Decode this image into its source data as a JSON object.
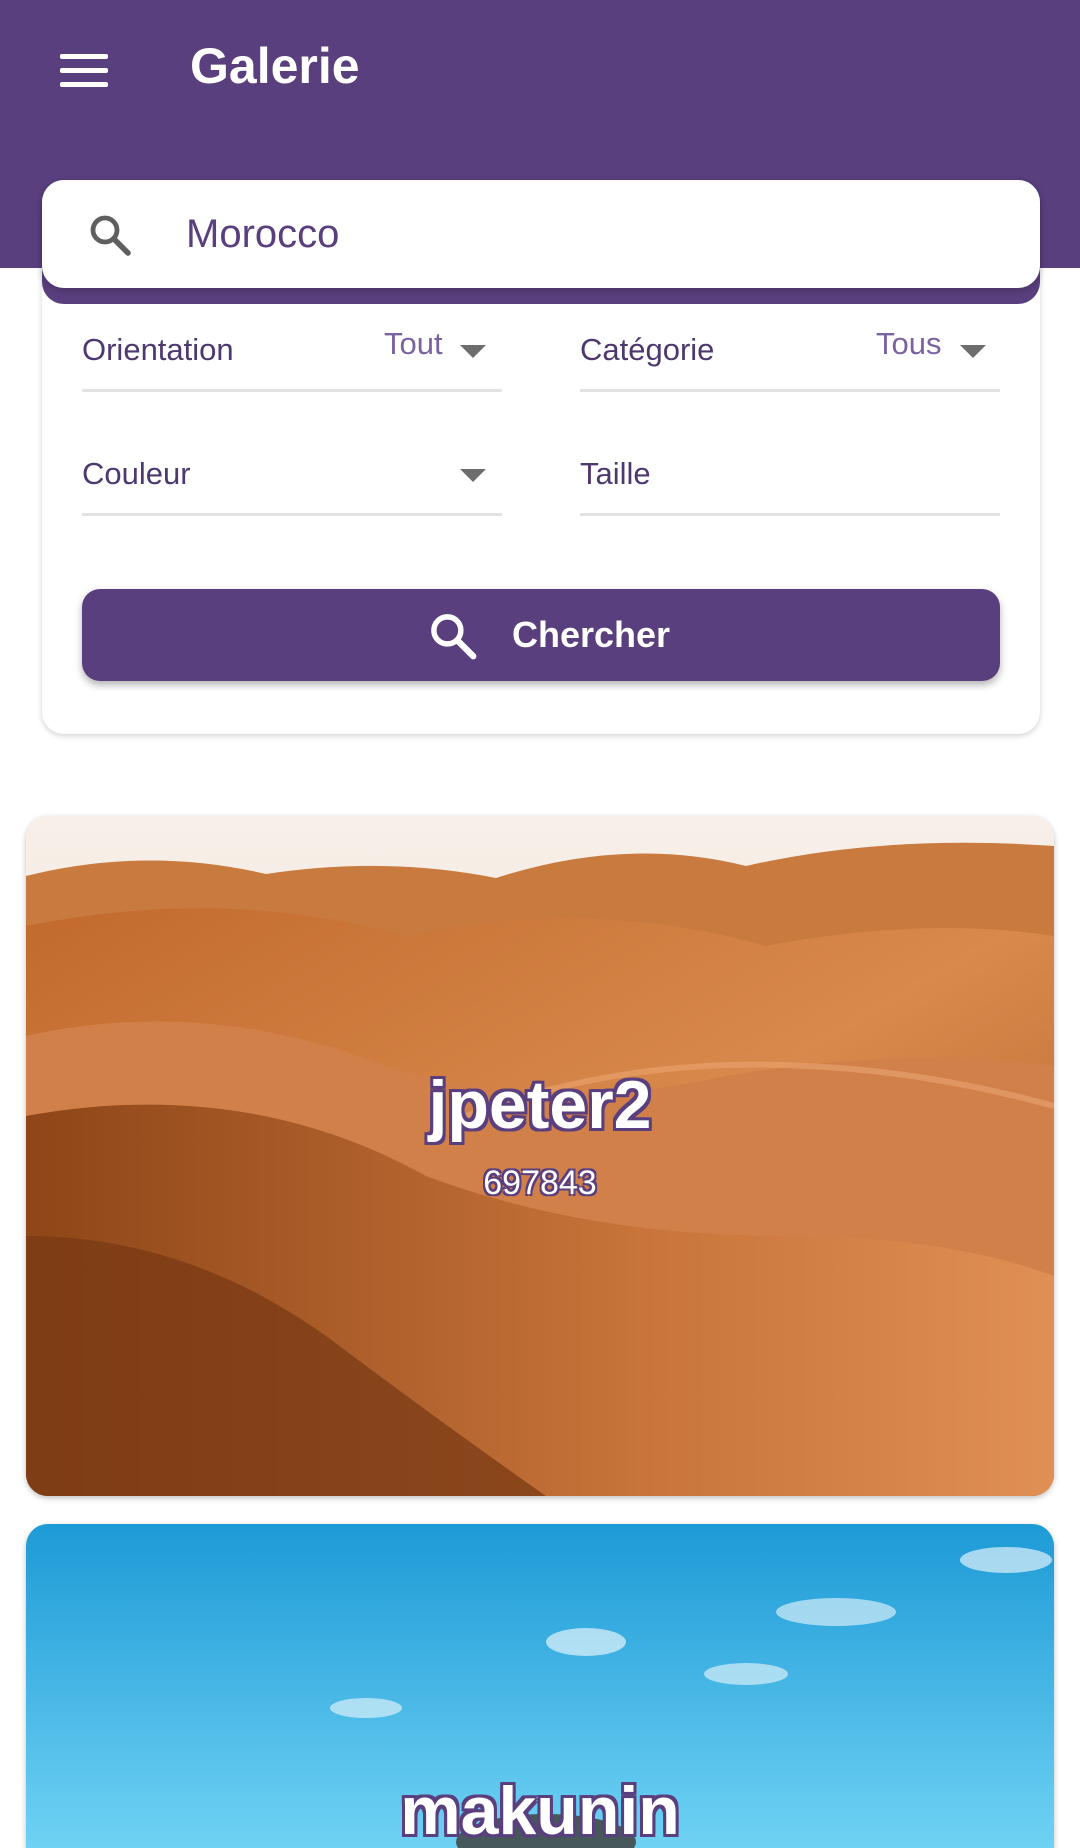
{
  "app": {
    "title": "Galerie"
  },
  "colors": {
    "primary": "#5a3f7e",
    "label": "#4d3870",
    "value": "#7a63a0"
  },
  "search": {
    "value": "Morocco",
    "icon": "search-icon"
  },
  "filters": {
    "orientation": {
      "label": "Orientation",
      "value": "Tout"
    },
    "category": {
      "label": "Catégorie",
      "value": "Tous"
    },
    "color": {
      "label": "Couleur",
      "value": ""
    },
    "size": {
      "label": "Taille",
      "value": ""
    }
  },
  "search_button": {
    "label": "Chercher",
    "icon": "search-icon"
  },
  "results": [
    {
      "user": "jpeter2",
      "id": "697843",
      "scene": "desert-dunes"
    },
    {
      "user": "makunin",
      "id": "",
      "scene": "blue-sky"
    }
  ]
}
